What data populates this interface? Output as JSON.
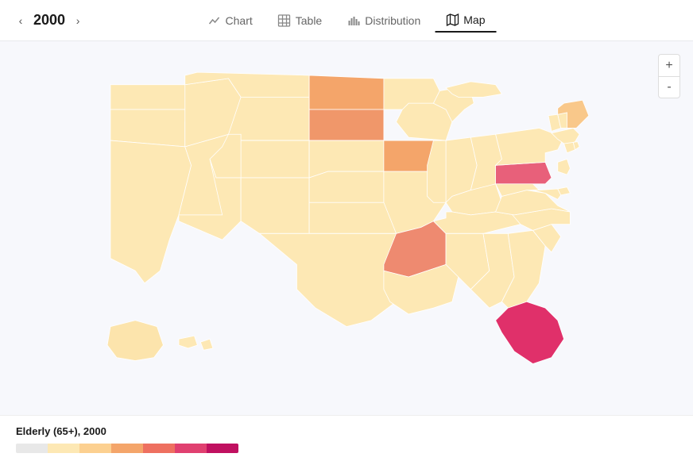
{
  "toolbar": {
    "year": "2000",
    "back_label": "‹",
    "forward_label": "›",
    "tabs": [
      {
        "id": "chart",
        "label": "Chart",
        "active": false
      },
      {
        "id": "table",
        "label": "Table",
        "active": false
      },
      {
        "id": "distribution",
        "label": "Distribution",
        "active": false
      },
      {
        "id": "map",
        "label": "Map",
        "active": true
      }
    ]
  },
  "zoom": {
    "plus_label": "+",
    "minus_label": "-"
  },
  "legend": {
    "title": "Elderly (65+), 2000"
  }
}
